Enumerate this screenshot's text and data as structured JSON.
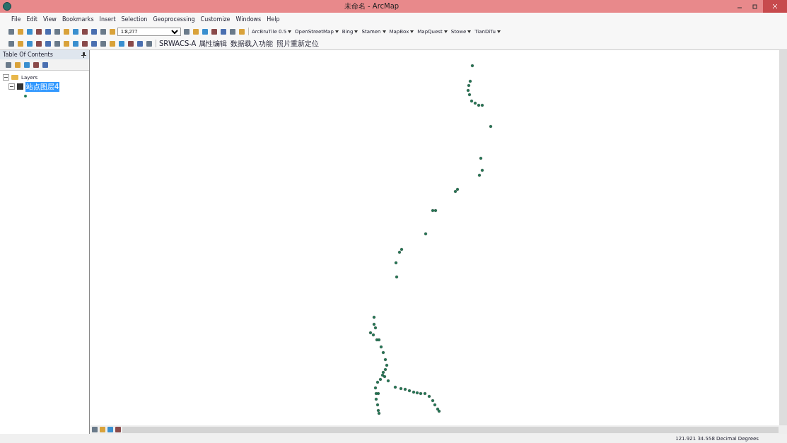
{
  "window": {
    "title": "未命名 - ArcMap"
  },
  "menu": [
    "File",
    "Edit",
    "View",
    "Bookmarks",
    "Insert",
    "Selection",
    "Geoprocessing",
    "Customize",
    "Windows",
    "Help"
  ],
  "standard_toolbar": {
    "scale": "1:8,277"
  },
  "tile_toolbar": {
    "label": "ArcBruTile 0.5",
    "menus": [
      "OpenStreetMap",
      "Bing",
      "Stamen",
      "MapBox",
      "MapQuest",
      "Stowe",
      "TianDiTu"
    ]
  },
  "custom_toolbar": [
    "SRWACS-A 属性编辑",
    "数据载入功能",
    "照片重新定位"
  ],
  "toc": {
    "title": "Table Of Contents",
    "root": {
      "label": "Layers",
      "expanded": true,
      "children": [
        {
          "label": "站点图层4",
          "checked": true,
          "selected": true,
          "expanded": true
        }
      ]
    }
  },
  "status_bar": {
    "coordinates": "121.921 34.558 Decimal Degrees"
  }
}
